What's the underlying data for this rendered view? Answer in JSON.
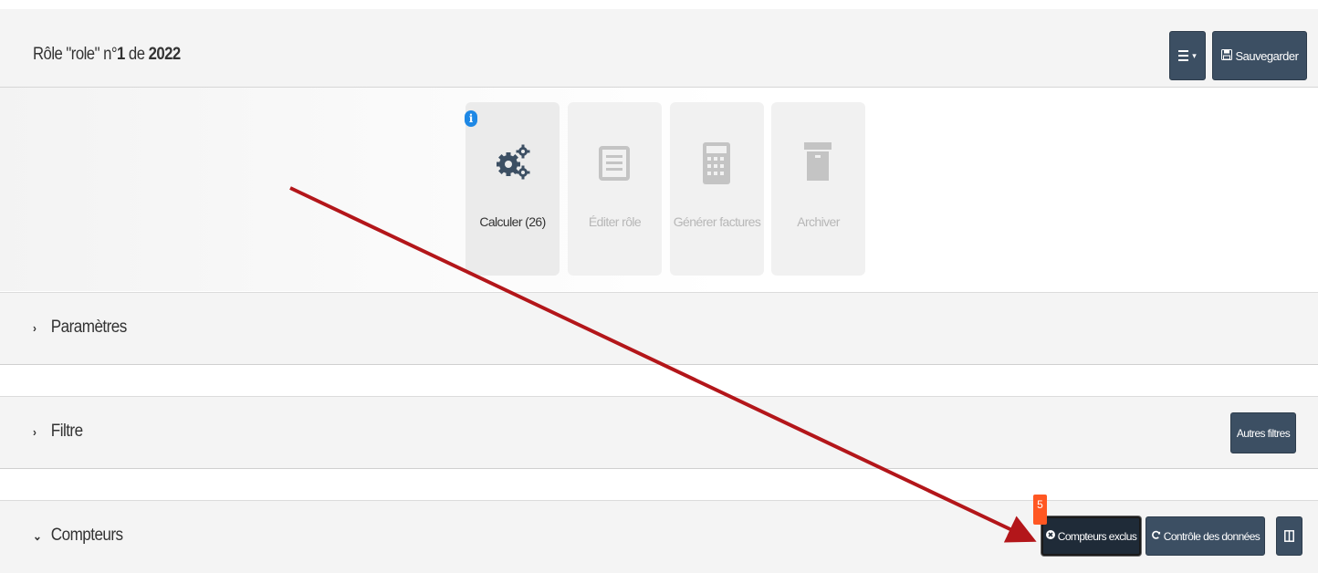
{
  "header": {
    "title_prefix": "Rôle \"role\" n°",
    "title_number": "1",
    "title_mid": " de ",
    "title_year": "2022",
    "save_label": "Sauvegarder"
  },
  "actions": [
    {
      "label": "Calculer (26)",
      "icon": "gears-icon",
      "active": true
    },
    {
      "label": "Éditer rôle",
      "icon": "list-icon",
      "active": false
    },
    {
      "label": "Générer factures",
      "icon": "calculator-icon",
      "active": false
    },
    {
      "label": "Archiver",
      "icon": "archive-icon",
      "active": false
    }
  ],
  "panels": {
    "parametres": {
      "title": "Paramètres",
      "collapsed": true
    },
    "filtre": {
      "title": "Filtre",
      "collapsed": true,
      "autres_filtres_label": "Autres filtres"
    },
    "compteurs": {
      "title": "Compteurs",
      "collapsed": false,
      "exclus_label": "Compteurs exclus",
      "exclus_badge": "5",
      "controle_label": "Contrôle des données"
    }
  },
  "colors": {
    "button_dark": "#3c4f63",
    "badge": "#ff5722",
    "info_icon": "#1e88e5",
    "annotation_arrow": "#b3161a"
  }
}
